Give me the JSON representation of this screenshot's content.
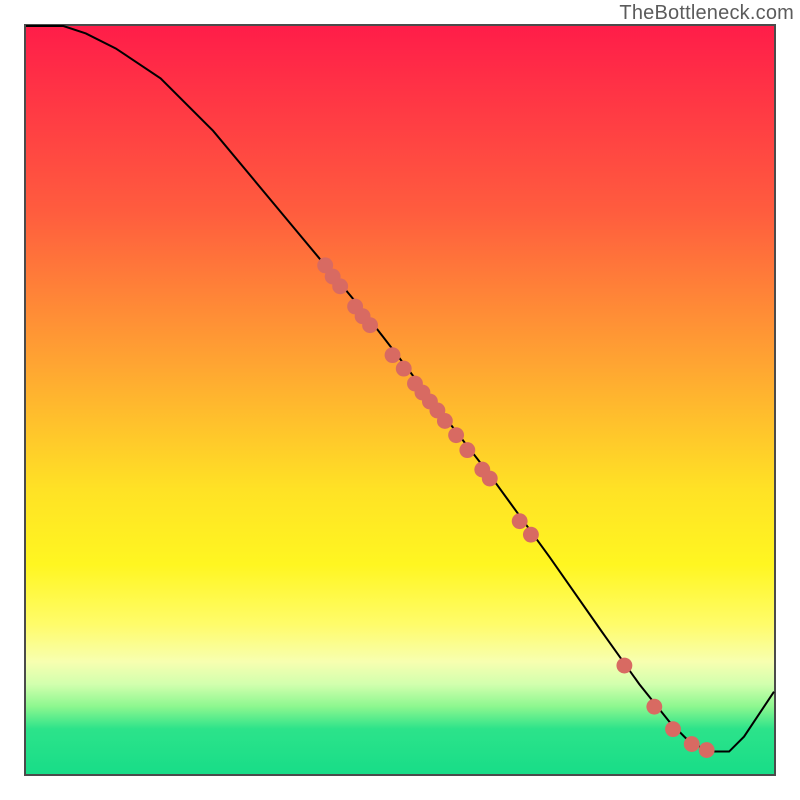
{
  "watermark": "TheBottleneck.com",
  "chart_data": {
    "type": "line",
    "title": "",
    "xlabel": "",
    "ylabel": "",
    "xlim": [
      0,
      100
    ],
    "ylim": [
      0,
      100
    ],
    "series": [
      {
        "name": "curve",
        "x": [
          0,
          5,
          8,
          12,
          18,
          25,
          35,
          45,
          55,
          62,
          70,
          77,
          82,
          86,
          89,
          92,
          94,
          96,
          100
        ],
        "values": [
          100,
          100,
          99,
          97,
          93,
          86,
          74,
          62,
          49,
          40,
          29,
          19,
          12,
          7,
          4,
          3,
          3,
          5,
          11
        ]
      }
    ],
    "markers": {
      "name": "cluster",
      "color": "#d86a62",
      "radius": 8,
      "points": [
        {
          "x": 40,
          "y": 68
        },
        {
          "x": 41,
          "y": 66.5
        },
        {
          "x": 42,
          "y": 65.2
        },
        {
          "x": 44,
          "y": 62.5
        },
        {
          "x": 45,
          "y": 61.2
        },
        {
          "x": 46,
          "y": 60
        },
        {
          "x": 49,
          "y": 56
        },
        {
          "x": 50.5,
          "y": 54.2
        },
        {
          "x": 52,
          "y": 52.2
        },
        {
          "x": 53,
          "y": 51
        },
        {
          "x": 54,
          "y": 49.8
        },
        {
          "x": 55,
          "y": 48.6
        },
        {
          "x": 56,
          "y": 47.2
        },
        {
          "x": 57.5,
          "y": 45.3
        },
        {
          "x": 59,
          "y": 43.3
        },
        {
          "x": 61,
          "y": 40.7
        },
        {
          "x": 62,
          "y": 39.5
        },
        {
          "x": 66,
          "y": 33.8
        },
        {
          "x": 67.5,
          "y": 32
        },
        {
          "x": 80,
          "y": 14.5
        },
        {
          "x": 84,
          "y": 9
        },
        {
          "x": 86.5,
          "y": 6
        },
        {
          "x": 89,
          "y": 4
        },
        {
          "x": 91,
          "y": 3.2
        }
      ]
    },
    "gradient_stops": [
      {
        "pos": 0,
        "color": "#ff1d49"
      },
      {
        "pos": 25,
        "color": "#ff5d3e"
      },
      {
        "pos": 45,
        "color": "#ffa432"
      },
      {
        "pos": 62,
        "color": "#ffe225"
      },
      {
        "pos": 72,
        "color": "#fff621"
      },
      {
        "pos": 80,
        "color": "#fffc6a"
      },
      {
        "pos": 85,
        "color": "#f7ffb0"
      },
      {
        "pos": 88,
        "color": "#d2ffae"
      },
      {
        "pos": 91,
        "color": "#8cf78f"
      },
      {
        "pos": 94,
        "color": "#2ce38a"
      },
      {
        "pos": 100,
        "color": "#18dd88"
      }
    ]
  }
}
